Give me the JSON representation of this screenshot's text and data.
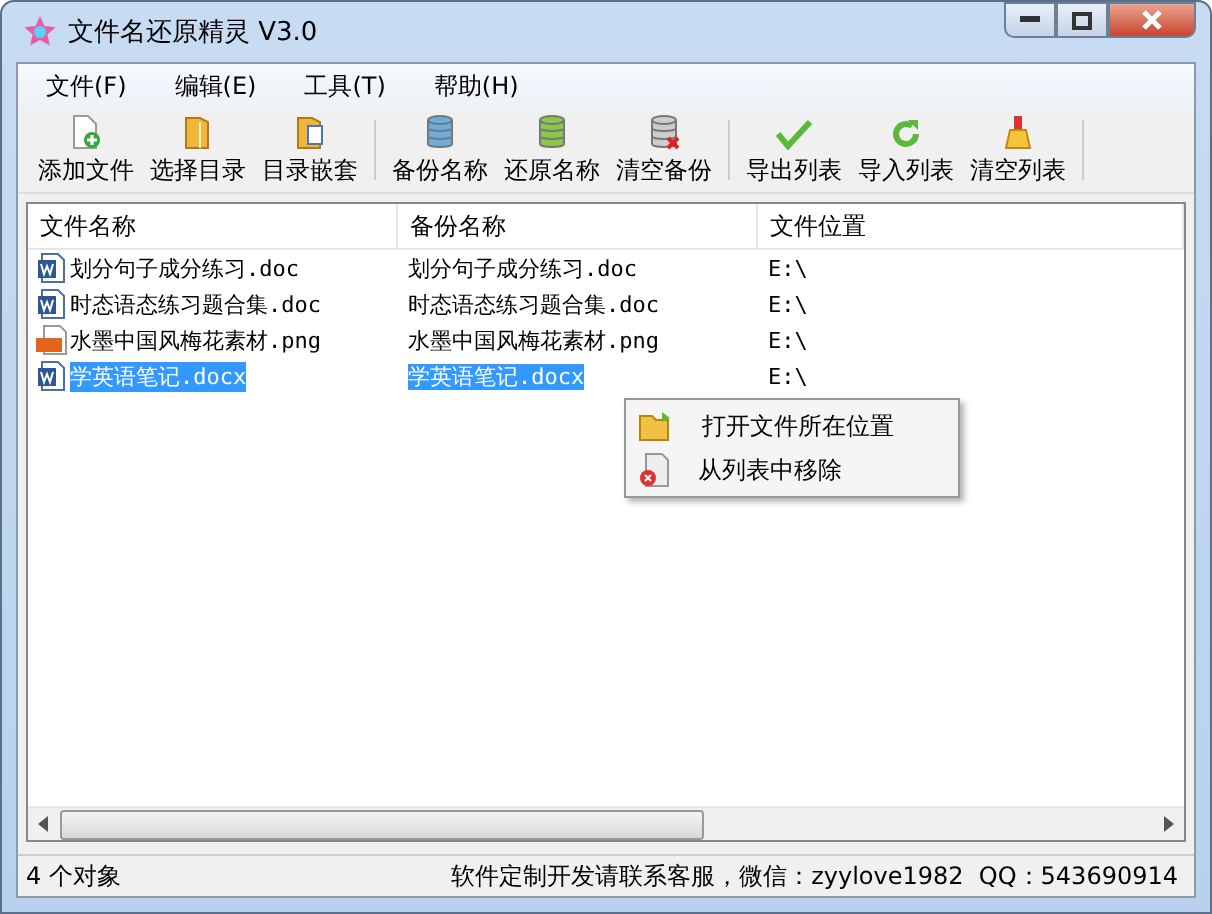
{
  "window": {
    "title": "文件名还原精灵 V3.0"
  },
  "menu": [
    "文件(F)",
    "编辑(E)",
    "工具(T)",
    "帮助(H)"
  ],
  "toolbar": [
    [
      "添加文件",
      "选择目录",
      "目录嵌套"
    ],
    [
      "备份名称",
      "还原名称",
      "清空备份"
    ],
    [
      "导出列表",
      "导入列表",
      "清空列表"
    ]
  ],
  "table": {
    "columns": [
      "文件名称",
      "备份名称",
      "文件位置"
    ],
    "rows": [
      {
        "kind": "word",
        "name": "划分句子成分练习.doc",
        "backup": "划分句子成分练习.doc",
        "location": "E:\\",
        "selected": false
      },
      {
        "kind": "word",
        "name": "时态语态练习题合集.doc",
        "backup": "时态语态练习题合集.doc",
        "location": "E:\\",
        "selected": false
      },
      {
        "kind": "png",
        "name": "水墨中国风梅花素材.png",
        "backup": "水墨中国风梅花素材.png",
        "location": "E:\\",
        "selected": false
      },
      {
        "kind": "word",
        "name": "学英语笔记.docx",
        "backup": "学英语笔记.docx",
        "location": "E:\\",
        "selected": true
      }
    ]
  },
  "context_menu": [
    "打开文件所在位置",
    "从列表中移除"
  ],
  "status_bar": {
    "count": "4 个对象",
    "contact": "软件定制开发请联系客服，微信：zyylove1982  QQ：543690914"
  }
}
